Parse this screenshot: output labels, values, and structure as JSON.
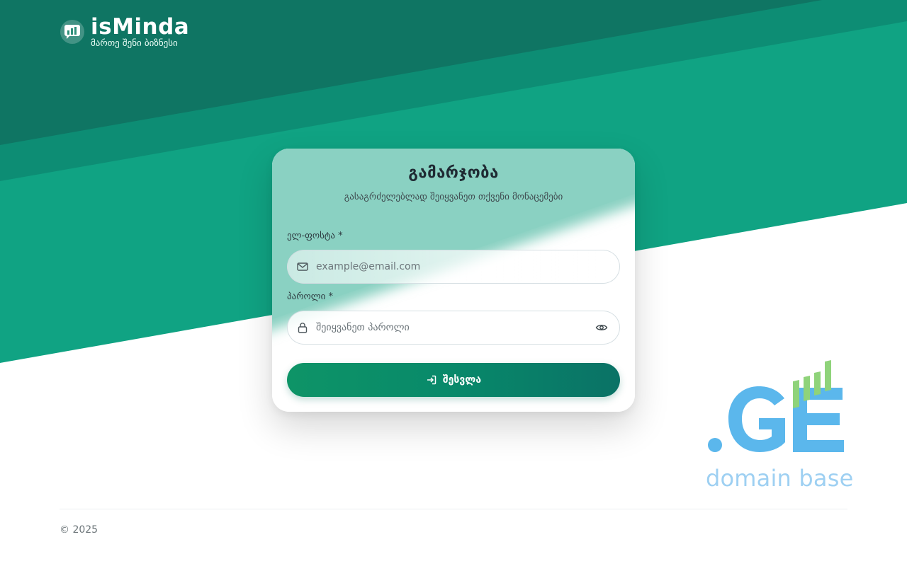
{
  "brand": {
    "name": "isMinda",
    "tagline": "მართე შენი ბიზნესი",
    "logo_icon": "bar-chart-bubble-icon"
  },
  "colors": {
    "primary_dark": "#0f7a69",
    "primary": "#10a383",
    "accent_green": "#8fd37a",
    "accent_blue": "#5bb7ec"
  },
  "login": {
    "title": "გამარჯობა",
    "subtitle": "გასაგრძელებლად შეიყვანეთ თქვენი მონაცემები",
    "email": {
      "label": "ელ-ფოსტა *",
      "placeholder": "example@email.com",
      "value": "",
      "icon": "mail-icon"
    },
    "password": {
      "label": "პაროლი *",
      "placeholder": "შეიყვანეთ პაროლი",
      "value": "",
      "icon": "lock-icon",
      "toggle_icon": "eye-icon"
    },
    "submit": {
      "label": "შესვლა",
      "icon": "login-arrow-icon"
    }
  },
  "partner": {
    "mark": ".GE",
    "text": "domain base"
  },
  "footer": {
    "copyright": "© 2025"
  }
}
